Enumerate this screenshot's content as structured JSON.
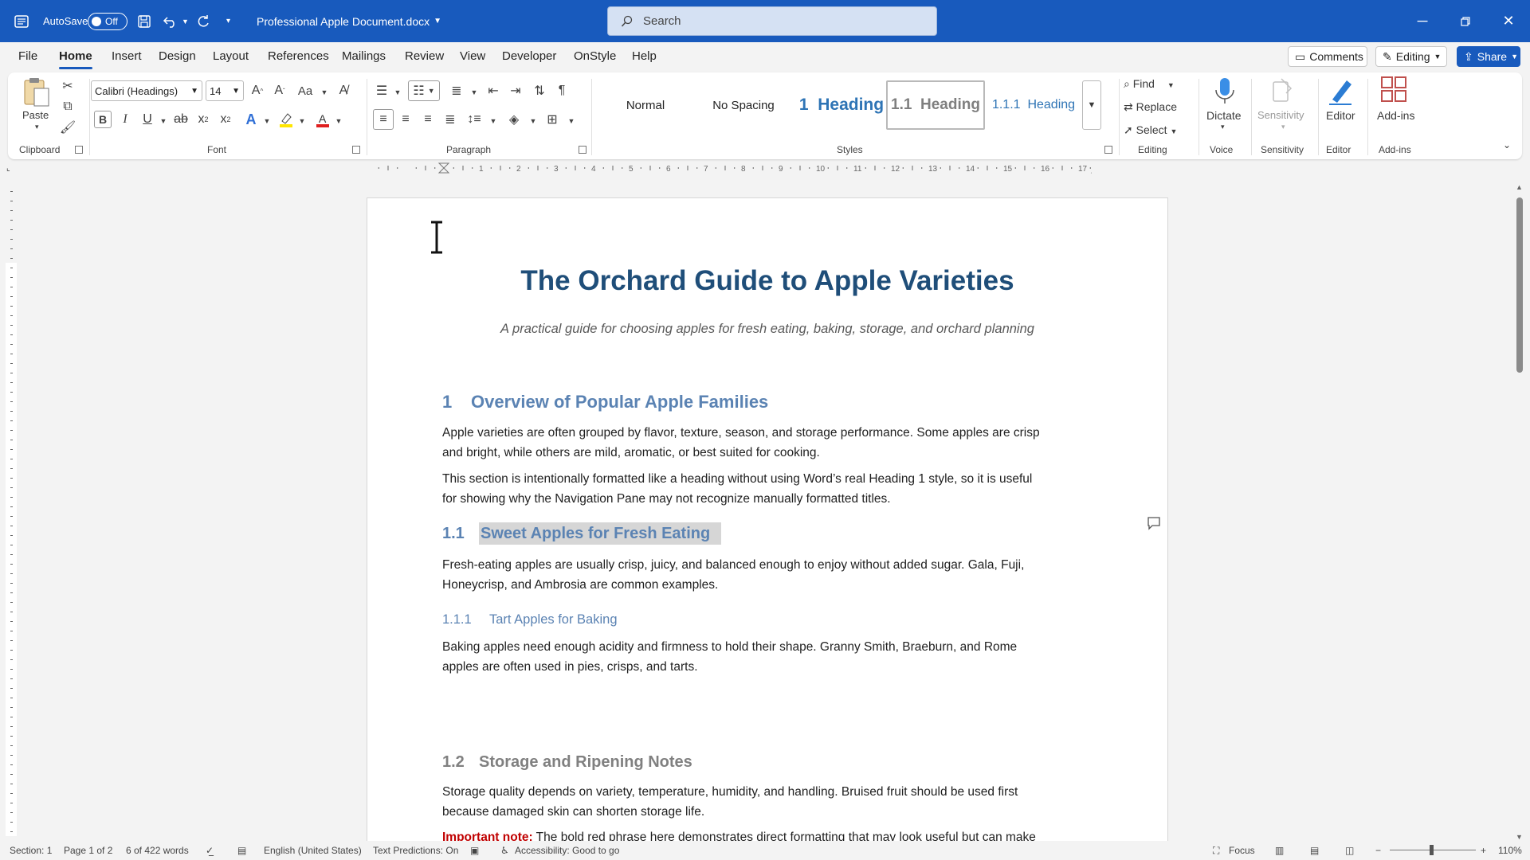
{
  "titlebar": {
    "autosave_label": "AutoSave",
    "autosave_state": "Off",
    "doc_name": "Professional Apple Document.docx",
    "search_placeholder": "Search"
  },
  "tabs": [
    "File",
    "Home",
    "Insert",
    "Design",
    "Layout",
    "References",
    "Mailings",
    "Review",
    "View",
    "Developer",
    "OnStyle",
    "Help"
  ],
  "active_tab": "Home",
  "top_buttons": {
    "comments": "Comments",
    "editing": "Editing",
    "share": "Share"
  },
  "ribbon": {
    "clipboard": {
      "paste": "Paste",
      "label": "Clipboard"
    },
    "font": {
      "family": "Calibri (Headings)",
      "size": "14",
      "label": "Font",
      "case": "Aa"
    },
    "paragraph": {
      "label": "Paragraph"
    },
    "styles": {
      "label": "Styles",
      "items": [
        {
          "num": "",
          "text": "Normal"
        },
        {
          "num": "",
          "text": "No Spacing"
        },
        {
          "num": "1",
          "text": "Heading"
        },
        {
          "num": "1.1",
          "text": "Heading"
        },
        {
          "num": "1.1.1",
          "text": "Heading"
        }
      ]
    },
    "editing": {
      "find": "Find",
      "replace": "Replace",
      "select": "Select",
      "label": "Editing"
    },
    "voice": {
      "dictate": "Dictate",
      "label": "Voice"
    },
    "sensitivity": {
      "button": "Sensitivity",
      "label": "Sensitivity"
    },
    "editor": {
      "button": "Editor",
      "label": "Editor"
    },
    "addins": {
      "button": "Add-ins",
      "label": "Add-ins"
    }
  },
  "ruler": [
    "1",
    "2",
    "3",
    "4",
    "5",
    "6",
    "7",
    "8",
    "9",
    "10",
    "11",
    "12",
    "13",
    "14",
    "15",
    "16",
    "17"
  ],
  "document": {
    "title": "The Orchard Guide to Apple Varieties",
    "subtitle": "A practical guide for choosing apples for fresh eating, baking, storage, and orchard planning",
    "h1": {
      "num": "1",
      "text": "Overview of Popular Apple Families"
    },
    "p1_l1": "Apple varieties are often grouped by flavor, texture, season, and storage performance. Some apples are crisp",
    "p1_l2": "and bright, while others are mild, aromatic, or best suited for cooking.",
    "p2_l1": "This section is intentionally formatted like a heading without using Word’s real Heading 1 style, so it is useful",
    "p2_l2": "for showing why the Navigation Pane may not recognize manually formatted titles.",
    "h11": {
      "num": "1.1",
      "text": "Sweet Apples for Fresh Eating"
    },
    "p3_l1": "Fresh-eating apples are usually crisp, juicy, and balanced enough to enjoy without added sugar. Gala, Fuji,",
    "p3_l2": "Honeycrisp, and Ambrosia are common examples.",
    "h111": {
      "num": "1.1.1",
      "text": "Tart Apples for Baking"
    },
    "p4_l1": "Baking apples need enough acidity and firmness to hold their shape. Granny Smith, Braeburn, and Rome",
    "p4_l2": "apples are often used in pies, crisps, and tarts.",
    "h12": {
      "num": "1.2",
      "text": "Storage and Ripening Notes"
    },
    "p5_l1": "Storage quality depends on variety, temperature, humidity, and handling. Bruised fruit should be used first",
    "p5_l2": "because damaged skin can shorten storage life.",
    "p6_label": "Important note:",
    "p6_text": " The bold red phrase here demonstrates direct formatting that may look useful but can make"
  },
  "status": {
    "section": "Section: 1",
    "page": "Page 1 of 2",
    "words": "6 of 422 words",
    "language": "English (United States)",
    "predictions": "Text Predictions: On",
    "accessibility": "Accessibility: Good to go",
    "focus": "Focus",
    "zoom": "110%"
  }
}
